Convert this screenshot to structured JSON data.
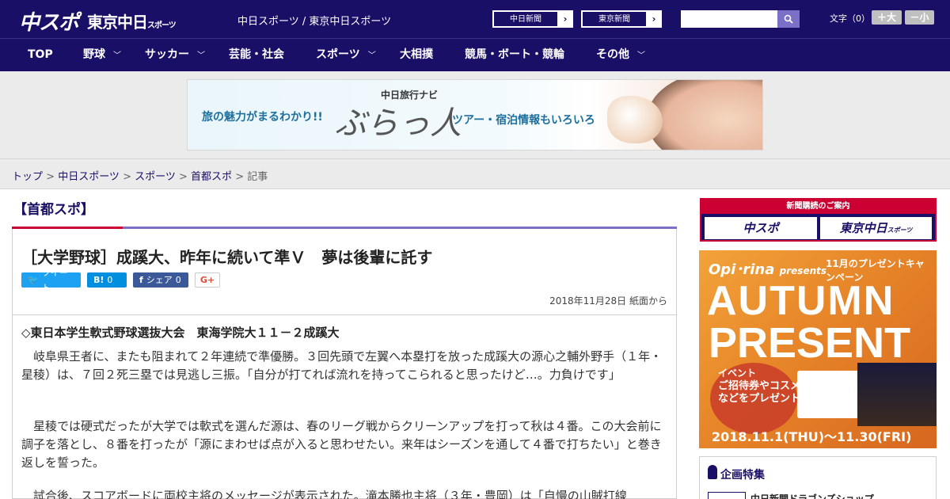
{
  "header": {
    "logo_chuspo": "中スポ",
    "logo_tokyo": "東京中日",
    "logo_tokyo_small": "スポーツ",
    "site_names": "中日スポーツ / 東京中日スポーツ",
    "ext_links": [
      "中日新聞",
      "東京新聞"
    ],
    "search_placeholder": "",
    "fontsize_label": "文字（0）",
    "fontsize_plus": "＋大",
    "fontsize_minus": "－小"
  },
  "nav": [
    {
      "label": "TOP",
      "has_menu": false
    },
    {
      "label": "野球",
      "has_menu": true
    },
    {
      "label": "サッカー",
      "has_menu": true
    },
    {
      "label": "芸能・社会",
      "has_menu": false
    },
    {
      "label": "スポーツ",
      "has_menu": true
    },
    {
      "label": "大相撲",
      "has_menu": false
    },
    {
      "label": "競馬・ボート・競輪",
      "has_menu": false
    },
    {
      "label": "その他",
      "has_menu": true
    }
  ],
  "banner": {
    "tagline_left": "旅の魅力がまるわかり!!",
    "brand_small": "中日旅行ナビ",
    "brand_big": "ぶらっ人",
    "tagline_right": "ツアー・宿泊情報もいろいろ"
  },
  "breadcrumb": {
    "items": [
      "トップ",
      "中日スポーツ",
      "スポーツ",
      "首都スポ"
    ],
    "current": "記事"
  },
  "article": {
    "category": "【首都スポ】",
    "headline": "［大学野球］成蹊大、昨年に続いて準Ｖ　夢は後輩に託す",
    "share": {
      "tweet": "ツイート",
      "hatena_label": "B!",
      "hatena_count": "0",
      "facebook": "シェア",
      "facebook_count": "0",
      "gplus": "G+"
    },
    "dateline": "2018年11月28日 紙面から",
    "subhead": "◇東日本学生軟式野球選抜大会　東海学院大１１－２成蹊大",
    "paragraphs": [
      "岐阜県王者に、またも阻まれて２年連続で準優勝。３回先頭で左翼へ本塁打を放った成蹊大の源心之輔外野手（１年・星稜）は、７回２死三塁では見逃し三振。「自分が打てれば流れを持ってこられると思ったけど…。力負けです」",
      "星稜では硬式だったが大学では軟式を選んだ源は、春のリーグ戦からクリーンアップを打って秋は４番。この大会前に調子を落とし、８番を打ったが「源にまわせば点が入ると思わせたい。来年はシーズンを通して４番で打ちたい」と巻き返しを誓った。",
      "試合後、スコアボードに両校主将のメッセージが表示された。滝本勝也主将（３年・豊岡）は「自慢の山賊打線"
    ]
  },
  "sidebar": {
    "subscribe_header": "新聞購読のご案内",
    "subscribe_left": "中スポ",
    "subscribe_right": "東京中日",
    "subscribe_right_small": "スポーツ",
    "ad": {
      "brand": "Opi･rina",
      "presents": "presents",
      "month": "11月のプレゼントキャンペーン",
      "line1": "AUTUMN",
      "line2": "PRESENT",
      "circle_small": "イベント",
      "circle_big": "ご招待券やコスメなどをプレゼント!",
      "dates": "2018.11.1(THU)～11.30(FRI)"
    },
    "special_title": "企画特集",
    "special_item": "中日新聞ドラゴンズショップ"
  }
}
